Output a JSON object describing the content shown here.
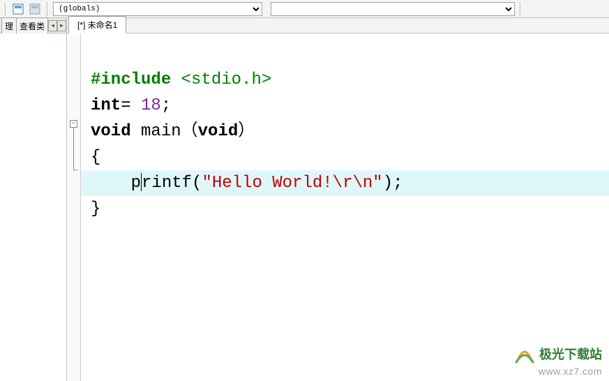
{
  "toolbar": {
    "scope_value": "(globals)",
    "symbol_value": ""
  },
  "left_panel": {
    "tabs": [
      "理",
      "查看类"
    ]
  },
  "file_tabs": {
    "active": "[*] 未命名1"
  },
  "code": {
    "line1": {
      "directive": "#include",
      "header": "<stdio.h>"
    },
    "line2": {
      "kw": "int",
      "op": "=",
      "num": "18",
      "semi": ";"
    },
    "line3": {
      "kw1": "void",
      "fn": "main",
      "lp": "（",
      "kw2": "void",
      "rp": "）"
    },
    "line4": "{",
    "line5": {
      "indent": "    ",
      "pre": "p",
      "post": "rintf",
      "lp": "(",
      "str": "\"Hello World!\\r\\n\"",
      "rp": ")",
      "semi": ";"
    },
    "line6": "}"
  },
  "watermark": {
    "brand": "极光下载站",
    "url": "www.xz7.com"
  }
}
